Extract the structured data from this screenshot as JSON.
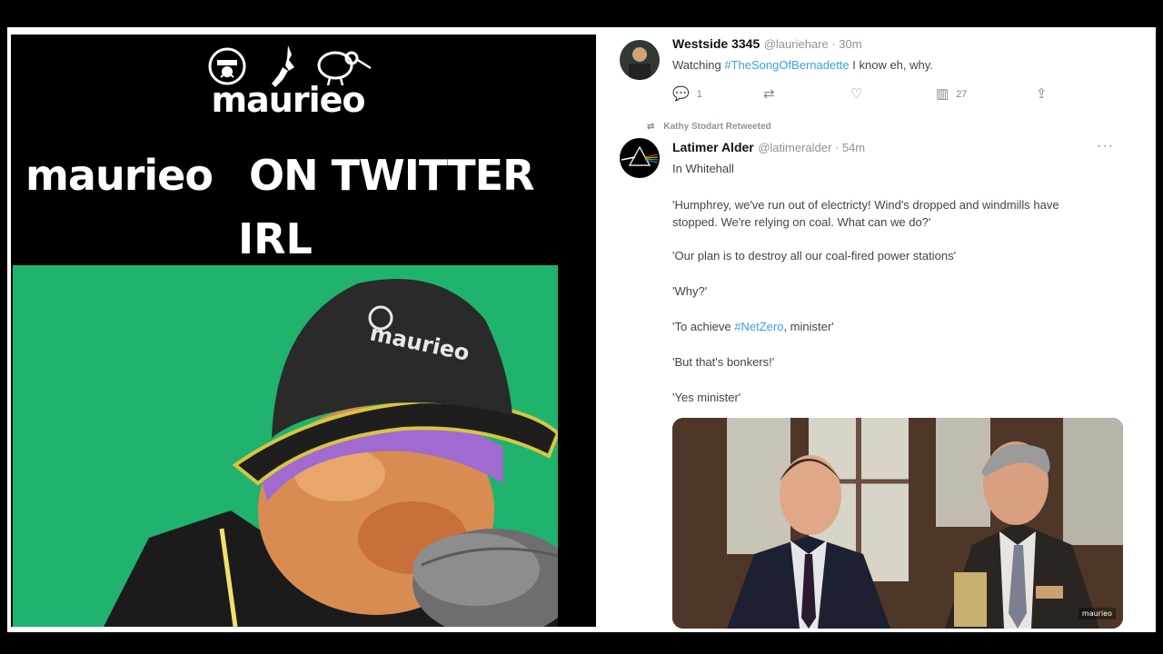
{
  "left": {
    "logo_glyphs": [
      "☺",
      "✦",
      "🥝"
    ],
    "brand": "maurieo",
    "headline_name": "maurieo",
    "headline_rest": "ON TWITTER",
    "headline_line2": "IRL",
    "webcam_background": "#20b36e",
    "hat_logo": "maurieo"
  },
  "tweet1": {
    "name": "Westside 3345",
    "handle": "@lauriehare · 30m",
    "text_prefix": "Watching ",
    "hashtag": "#TheSongOfBernadette",
    "text_suffix": " I know eh, why.",
    "reply_count": "1",
    "view_count": "27"
  },
  "retweet_label": "Kathy Stodart Retweeted",
  "tweet2": {
    "name": "Latimer Alder",
    "handle": "@latimeralder · 54m",
    "location": "In Whitehall",
    "lines": [
      "'Humphrey, we've run out of electricty! Wind's dropped and windmills have",
      "stopped. We're relying on coal. What can we do?'",
      "'Our plan is to destroy all our coal-fired power stations'",
      "'Why?'",
      "'To achieve ",
      "#NetZero",
      ", minister'",
      "'But that's bonkers!'",
      "'Yes minister'"
    ]
  },
  "photo_watermark": "maurieo",
  "colors": {
    "link": "#3aa0e8",
    "green_screen": "#20b36e",
    "background": "#000000"
  }
}
